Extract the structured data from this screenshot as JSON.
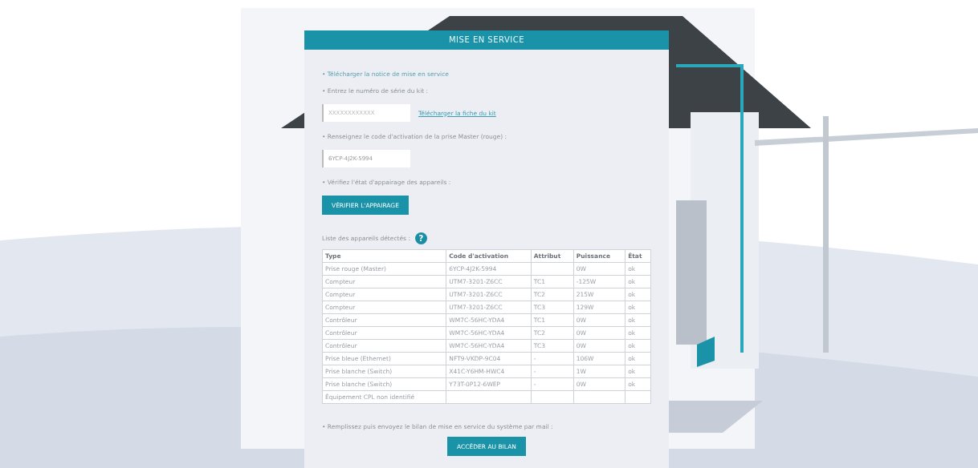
{
  "panel": {
    "title": "MISE EN SERVICE"
  },
  "steps": [
    {
      "kind": "link",
      "text": "• Télécharger la notice de mise en service"
    },
    {
      "kind": "text",
      "text": "• Entrez le numéro de série du kit :"
    }
  ],
  "serial": {
    "placeholder": "XXXXXXXXXXXX",
    "link": "Télécharger la fiche du kit"
  },
  "activation": {
    "label": "• Renseignez le code d'activation de la prise Master (rouge) :",
    "value": "6YCP-4J2K-5994"
  },
  "pairing": {
    "label": "• Vérifiez l'état d'appairage des appareils :",
    "button": "VÉRIFIER L'APPAIRAGE"
  },
  "devices": {
    "label": "Liste des appareils détectés :",
    "help": "?",
    "table": {
      "columns": [
        "Type",
        "Code d'activation",
        "Attribut",
        "Puissance",
        "État"
      ],
      "rows": [
        [
          "Prise rouge (Master)",
          "6YCP-4J2K-5994",
          "",
          "0W",
          "ok"
        ],
        [
          "Compteur",
          "UTM7-3201-Z6CC",
          "TC1",
          "-125W",
          "ok"
        ],
        [
          "Compteur",
          "UTM7-3201-Z6CC",
          "TC2",
          "215W",
          "ok"
        ],
        [
          "Compteur",
          "UTM7-3201-Z6CC",
          "TC3",
          "129W",
          "ok"
        ],
        [
          "Contrôleur",
          "WM7C-56HC-YDA4",
          "TC1",
          "0W",
          "ok"
        ],
        [
          "Contrôleur",
          "WM7C-56HC-YDA4",
          "TC2",
          "0W",
          "ok"
        ],
        [
          "Contrôleur",
          "WM7C-56HC-YDA4",
          "TC3",
          "0W",
          "ok"
        ],
        [
          "Prise bleue (Ethernet)",
          "NFT9-VKDP-9C04",
          "-",
          "106W",
          "ok"
        ],
        [
          "Prise blanche (Switch)",
          "X41C-Y6HM-HWC4",
          "-",
          "1W",
          "ok"
        ],
        [
          "Prise blanche (Switch)",
          "Y73T-0P12-6WEP",
          "-",
          "0W",
          "ok"
        ],
        [
          "Équipement CPL non identifié",
          "",
          "",
          "",
          ""
        ]
      ]
    }
  },
  "report": {
    "label": "• Remplissez puis envoyez le bilan de mise en service du système par mail :",
    "button": "ACCÉDER AU BILAN"
  }
}
